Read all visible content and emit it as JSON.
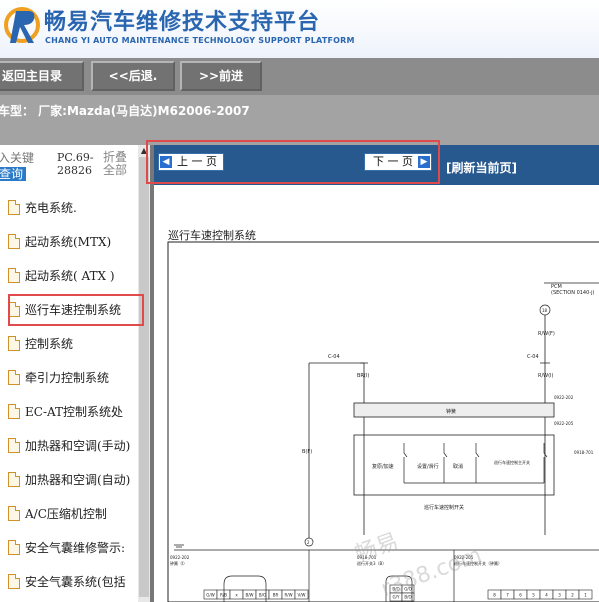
{
  "header": {
    "title_cn": "畅易汽车维修技术支持平台",
    "title_en": "CHANG YI AUTO MAINTENANCE TECHNOLOGY SUPPORT PLATFORM"
  },
  "nav": {
    "home_label": "返回主目录",
    "back_label": "<<后退.",
    "forward_label": ">>前进"
  },
  "model_bar": {
    "text": "车型：  厂家:Mazda(马自达)M62006-2007"
  },
  "left_tabs": {
    "keyword_line1": "入关键",
    "keyword_line2": "查询",
    "code_line1": "PC.69-",
    "code_line2": "28826",
    "collapse_line1": "折叠",
    "collapse_line2": "全部"
  },
  "tree_items": [
    "充电系统.",
    "起动系统(MTX)",
    "起动系统( ATX )",
    "巡行车速控制系统",
    "控制系统",
    "牵引力控制系统",
    "EC-AT控制系统处",
    "加热器和空调(手动)",
    "加热器和空调(自动)",
    "A/C压缩机控制",
    "安全气囊维修警示:",
    "安全气囊系统(包括"
  ],
  "pager": {
    "prev_label": "上 一 页",
    "next_label": "下 一 页",
    "refresh_label": "[刷新当前页]"
  },
  "diagram": {
    "title": "巡行车速控制系统",
    "pcm_label": "PCM",
    "pcm_section": "(SECTION 0140-j)",
    "pin_18": "18",
    "wire_rwf": "R/W(F)",
    "conn_c04_left": "C-04",
    "conn_c04_right": "C-04",
    "wire_bri": "BR(I)",
    "wire_rwi": "R/W(I)",
    "conn_0922_202": "0922-202",
    "conn_0922_205": "0922-205",
    "clock_spring": "钟簧",
    "sw_resume": "复原/加速",
    "sw_set": "设置/滑行",
    "sw_cancel": "取消",
    "sw_main": "巡行车速控制主开关",
    "switch_caption": "巡行车速控制开关",
    "conn_0918_701": "0918-701",
    "wire_bf": "B(F)",
    "node_2": "2",
    "conn_0922_202_b": "0922-202",
    "clock_spring_b": "钟簧（I）",
    "conn_0918_701_b": "0918-701",
    "sw_label_b": "巡行开关3（B）",
    "conn_0922_205_b": "0922-205",
    "sw_label_c": "巡行车速控制开关（钟簧）",
    "pins_left": [
      "G/W",
      "R/B",
      "x",
      "B/W",
      "B/O",
      "BR",
      "R/W",
      "V/W"
    ],
    "pins_mid_top": [
      "B/O",
      "G/O"
    ],
    "pins_mid_bot": [
      "G/Y",
      "B/O"
    ],
    "pins_right": [
      "8",
      "7",
      "6",
      "5",
      "4",
      "3",
      "2",
      "1"
    ]
  },
  "watermarks": [
    "畅易",
    "r388.com"
  ]
}
